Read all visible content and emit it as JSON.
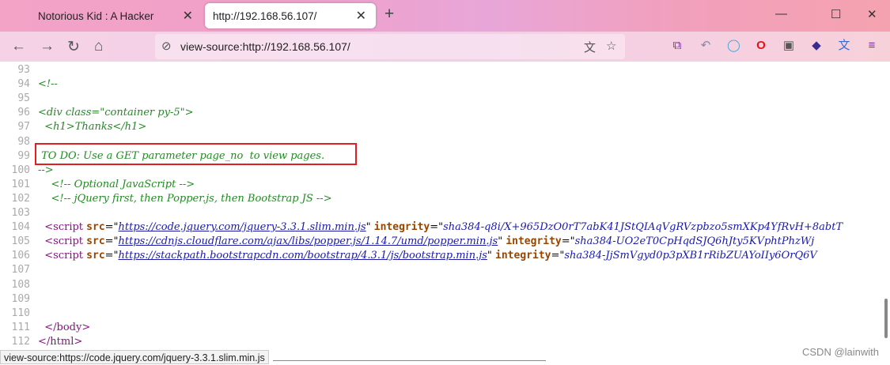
{
  "tabs": [
    {
      "title": "Notorious Kid : A Hacker",
      "close": "✕"
    },
    {
      "title": "http://192.168.56.107/",
      "close": "✕"
    }
  ],
  "new_tab": "+",
  "window": {
    "minimize": "—",
    "maximize": "☐",
    "close": "✕"
  },
  "address_bar": {
    "url": "view-source:http://192.168.56.107/"
  },
  "source_lines": [
    {
      "n": "93",
      "parts": []
    },
    {
      "n": "94",
      "parts": [
        {
          "c": "cm",
          "t": "<!--"
        }
      ]
    },
    {
      "n": "95",
      "parts": []
    },
    {
      "n": "96",
      "parts": [
        {
          "c": "cm",
          "t": "<div class=\"container py-5\">"
        }
      ]
    },
    {
      "n": "97",
      "parts": [
        {
          "c": "cm",
          "t": "  <h1>Thanks</h1>"
        }
      ]
    },
    {
      "n": "98",
      "parts": []
    },
    {
      "n": "99",
      "parts": [
        {
          "c": "cm",
          "t": " TO DO: Use a GET parameter page_no  to view pages."
        }
      ]
    },
    {
      "n": "100",
      "parts": [
        {
          "c": "cm",
          "t": "-->"
        }
      ]
    },
    {
      "n": "101",
      "parts": [
        {
          "c": "cm",
          "t": "    <!-- Optional JavaScript -->"
        }
      ]
    },
    {
      "n": "102",
      "parts": [
        {
          "c": "cm",
          "t": "    <!-- jQuery first, then Popper.js, then Bootstrap JS -->"
        }
      ]
    },
    {
      "n": "103",
      "parts": []
    },
    {
      "n": "104",
      "parts": [
        {
          "c": "txt",
          "t": "  "
        },
        {
          "c": "tg",
          "t": "<script "
        },
        {
          "c": "at",
          "t": "src"
        },
        {
          "c": "txt",
          "t": "=\""
        },
        {
          "c": "lk",
          "t": "https://code.jquery.com/jquery-3.3.1.slim.min.js"
        },
        {
          "c": "txt",
          "t": "\" "
        },
        {
          "c": "at",
          "t": "integrity"
        },
        {
          "c": "txt",
          "t": "=\""
        },
        {
          "c": "av",
          "t": "sha384-q8i/X+965DzO0rT7abK41JStQIAqVgRVzpbzo5smXKp4YfRvH+8abtT"
        }
      ]
    },
    {
      "n": "105",
      "parts": [
        {
          "c": "txt",
          "t": "  "
        },
        {
          "c": "tg",
          "t": "<script "
        },
        {
          "c": "at",
          "t": "src"
        },
        {
          "c": "txt",
          "t": "=\""
        },
        {
          "c": "lk",
          "t": "https://cdnjs.cloudflare.com/ajax/libs/popper.js/1.14.7/umd/popper.min.js"
        },
        {
          "c": "txt",
          "t": "\" "
        },
        {
          "c": "at",
          "t": "integrity"
        },
        {
          "c": "txt",
          "t": "=\""
        },
        {
          "c": "av",
          "t": "sha384-UO2eT0CpHqdSJQ6hJty5KVphtPhzWj"
        }
      ]
    },
    {
      "n": "106",
      "parts": [
        {
          "c": "txt",
          "t": "  "
        },
        {
          "c": "tg",
          "t": "<script "
        },
        {
          "c": "at",
          "t": "src"
        },
        {
          "c": "txt",
          "t": "=\""
        },
        {
          "c": "lk",
          "t": "https://stackpath.bootstrapcdn.com/bootstrap/4.3.1/js/bootstrap.min.js"
        },
        {
          "c": "txt",
          "t": "\" "
        },
        {
          "c": "at",
          "t": "integrity"
        },
        {
          "c": "txt",
          "t": "=\""
        },
        {
          "c": "av",
          "t": "sha384-JjSmVgyd0p3pXB1rRibZUAYoIIy6OrQ6V"
        }
      ]
    },
    {
      "n": "107",
      "parts": []
    },
    {
      "n": "108",
      "parts": []
    },
    {
      "n": "109",
      "parts": []
    },
    {
      "n": "110",
      "parts": []
    },
    {
      "n": "111",
      "parts": [
        {
          "c": "txt",
          "t": "  "
        },
        {
          "c": "tg",
          "t": "</body>"
        }
      ]
    },
    {
      "n": "112",
      "parts": [
        {
          "c": "tg",
          "t": "</html>"
        }
      ]
    }
  ],
  "status_bar": {
    "text": "view-source:https://code.jquery.com/jquery-3.3.1.slim.min.js"
  },
  "watermark": "CSDN @lainwith",
  "toolbar_icons": [
    "back-icon",
    "forward-icon",
    "reload-icon",
    "home-icon"
  ],
  "extension_icons": [
    "crop-icon",
    "undo-icon",
    "circle-icon",
    "opera-icon",
    "bookmark-icon",
    "layers-icon",
    "translate-icon",
    "menu-icon"
  ],
  "colors": {
    "comment": "#228b22",
    "tag": "#881280",
    "attr": "#994500",
    "link": "#1a1aa6",
    "highlight_box": "#e02020"
  }
}
